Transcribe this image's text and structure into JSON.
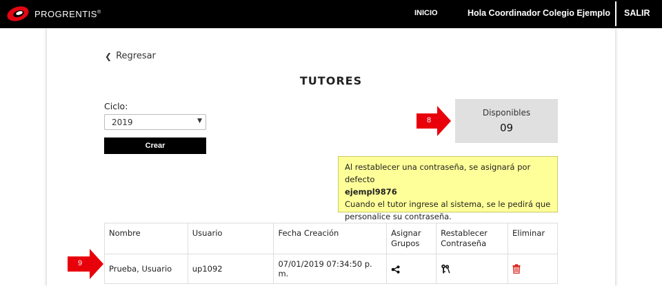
{
  "header": {
    "brand": "PROGRENTIS",
    "brand_mark": "®",
    "nav_inicio": "INICIO",
    "greeting": "Hola Coordinador Colegio Ejemplo",
    "logout": "SALIR"
  },
  "back_link": "Regresar",
  "title": "TUTORES",
  "ciclo": {
    "label": "Ciclo:",
    "selected": "2019"
  },
  "create_button": "Crear",
  "disponibles": {
    "label": "Disponibles",
    "value": "09"
  },
  "notice": {
    "line1": "Al restablecer una contraseña, se asignará por defecto",
    "password": "ejempl9876",
    "line2": "Cuando el tutor ingrese al sistema, se le pedirá que personalice su contraseña."
  },
  "callouts": {
    "arrow_8": "8",
    "arrow_9": "9"
  },
  "table": {
    "headers": {
      "nombre": "Nombre",
      "usuario": "Usuario",
      "fecha": "Fecha Creación",
      "asignar": "Asignar Grupos",
      "restablecer": "Restablecer Contraseña",
      "eliminar": "Eliminar"
    },
    "rows": [
      {
        "nombre": "Prueba, Usuario",
        "usuario": "up1092",
        "fecha": "07/01/2019 07:34:50 p. m."
      }
    ]
  },
  "colors": {
    "topbar": "#000000",
    "logo_red": "#e30613",
    "notice_bg": "#ffff99",
    "callout_red": "#e8000b",
    "delete_red": "#d9261c"
  }
}
